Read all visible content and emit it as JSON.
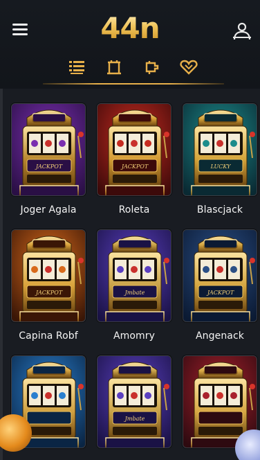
{
  "header": {
    "logo_text": "44n",
    "menu_icon": "hamburger-menu-icon",
    "user_icon": "user-account-icon"
  },
  "tabs": [
    {
      "icon": "list-icon"
    },
    {
      "icon": "table-icon"
    },
    {
      "icon": "coin-icon"
    },
    {
      "icon": "heart-icon"
    }
  ],
  "games": [
    {
      "title": "Joger Agala",
      "theme": "purple",
      "sign": "JACKPOT"
    },
    {
      "title": "Roleta",
      "theme": "red",
      "sign": "JACKPOT"
    },
    {
      "title": "Blascjack",
      "theme": "teal",
      "sign": "LUCKY"
    },
    {
      "title": "Capina Robf",
      "theme": "orange",
      "sign": "JACKPOT"
    },
    {
      "title": "Amomry",
      "theme": "violet",
      "sign": "Jmbate"
    },
    {
      "title": "Angenack",
      "theme": "navy",
      "sign": "JACKPOT"
    },
    {
      "title": "",
      "theme": "blue",
      "sign": ""
    },
    {
      "title": "",
      "theme": "violet",
      "sign": "Jmbate"
    },
    {
      "title": "",
      "theme": "crimson",
      "sign": ""
    }
  ],
  "colors": {
    "accent_gold": "#e7b04a",
    "background": "#191c22",
    "header_bg": "#14171c"
  }
}
